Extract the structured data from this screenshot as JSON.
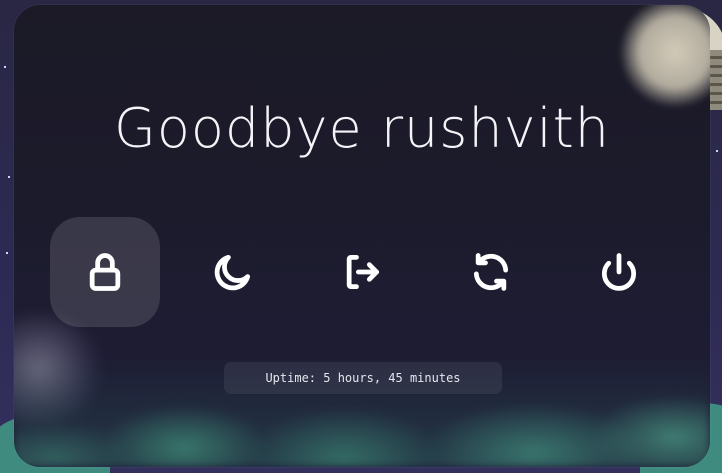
{
  "greeting": {
    "title": "Goodbye rushvith"
  },
  "actions": [
    {
      "id": "lock",
      "icon": "lock-icon",
      "active": true
    },
    {
      "id": "suspend",
      "icon": "moon-icon",
      "active": false
    },
    {
      "id": "logout",
      "icon": "logout-icon",
      "active": false
    },
    {
      "id": "reboot",
      "icon": "refresh-icon",
      "active": false
    },
    {
      "id": "shutdown",
      "icon": "power-icon",
      "active": false
    }
  ],
  "status": {
    "uptime": "Uptime: 5 hours, 45 minutes"
  },
  "colors": {
    "panel": "#1c1b2c",
    "accent_hover": "rgba(255,255,255,0.13)",
    "text": "#f4f4f8"
  }
}
